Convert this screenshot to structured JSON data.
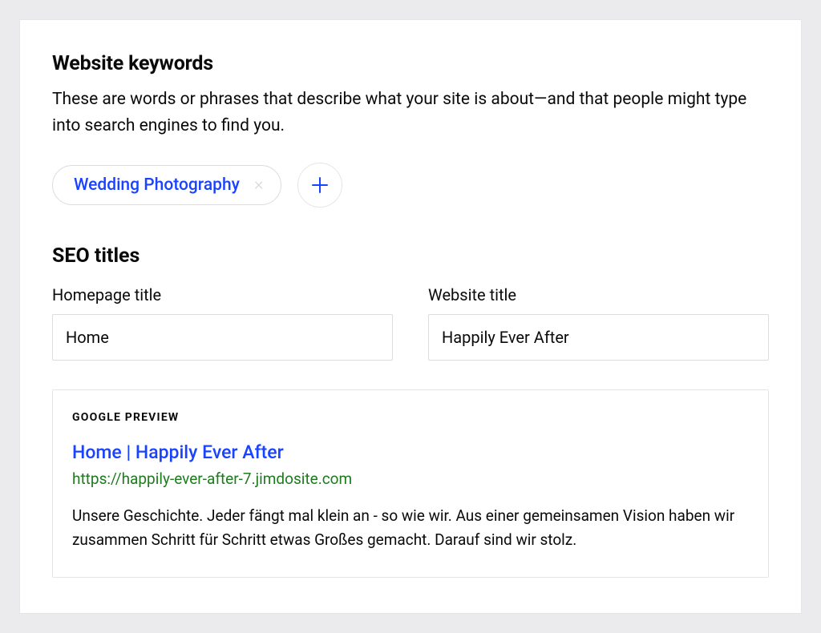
{
  "keywords": {
    "heading": "Website keywords",
    "description": "These are words or phrases that describe what your site is about—and that people might type into search engines to find you.",
    "chips": [
      {
        "label": "Wedding Photography"
      }
    ]
  },
  "seo": {
    "heading": "SEO titles",
    "fields": {
      "homepage": {
        "label": "Homepage title",
        "value": "Home"
      },
      "website": {
        "label": "Website title",
        "value": "Happily Ever After"
      }
    }
  },
  "preview": {
    "label": "GOOGLE PREVIEW",
    "title": "Home | Happily Ever After",
    "url": "https://happily-ever-after-7.jimdosite.com",
    "description": "Unsere Geschichte. Jeder fängt mal klein an - so wie wir. Aus einer gemeinsamen Vision haben wir zusammen Schritt für Schritt etwas Großes gemacht. Darauf sind wir stolz."
  },
  "colors": {
    "accent": "#1a43ff",
    "urlGreen": "#1e7b1e"
  }
}
